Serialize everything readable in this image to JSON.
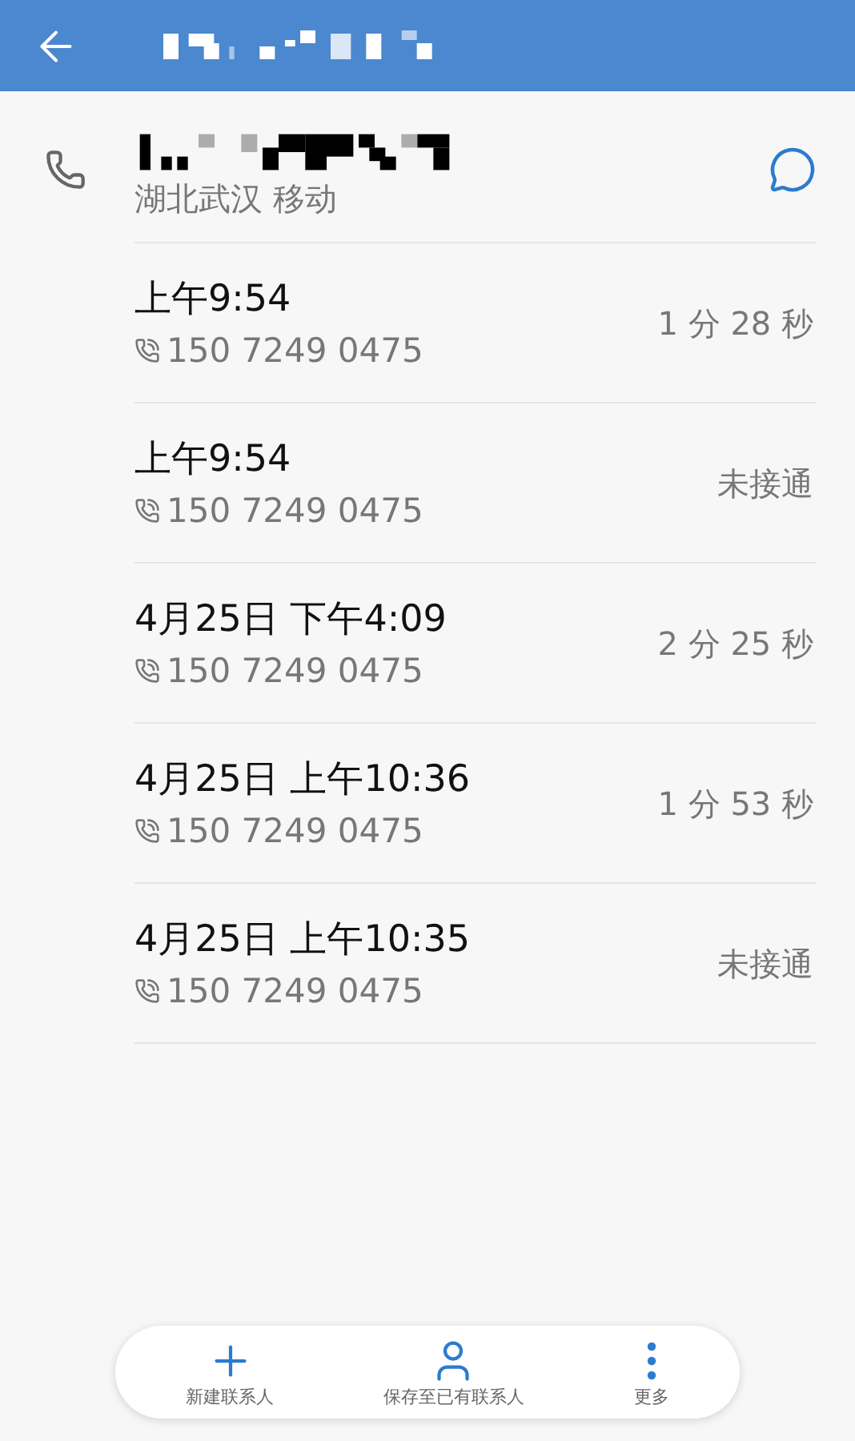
{
  "contact": {
    "location": "湖北武汉 移动"
  },
  "calls": [
    {
      "time": "上午9:54",
      "number": "150 7249 0475",
      "duration": "1 分 28 秒"
    },
    {
      "time": "上午9:54",
      "number": "150 7249 0475",
      "duration": "未接通"
    },
    {
      "time": "4月25日 下午4:09",
      "number": "150 7249 0475",
      "duration": "2 分 25 秒"
    },
    {
      "time": "4月25日 上午10:36",
      "number": "150 7249 0475",
      "duration": "1 分 53 秒"
    },
    {
      "time": "4月25日 上午10:35",
      "number": "150 7249 0475",
      "duration": "未接通"
    }
  ],
  "actions": [
    {
      "kind": "add",
      "label": "新建联系人"
    },
    {
      "kind": "person",
      "label": "保存至已有联系人"
    },
    {
      "kind": "more",
      "label": "更多"
    }
  ]
}
